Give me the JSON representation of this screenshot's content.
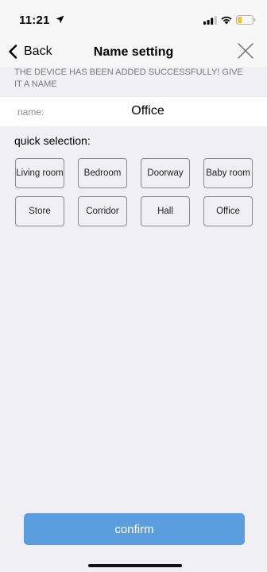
{
  "status_bar": {
    "time": "11:21",
    "battery_level": 0.3
  },
  "nav": {
    "back_label": "Back",
    "title": "Name setting"
  },
  "notice": "THE DEVICE HAS BEEN ADDED SUCCESSFULLY! GIVE IT A NAME",
  "name_field": {
    "label": "name:",
    "value": "Office"
  },
  "quick_selection": {
    "title": "quick selection:",
    "options": [
      "Living room",
      "Bedroom",
      "Doorway",
      "Baby room",
      "Store",
      "Corridor",
      "Hall",
      "Office"
    ]
  },
  "confirm_label": "confirm",
  "colors": {
    "accent": "#5b9ee0",
    "background": "#efeff4",
    "battery": "#f4c430"
  }
}
